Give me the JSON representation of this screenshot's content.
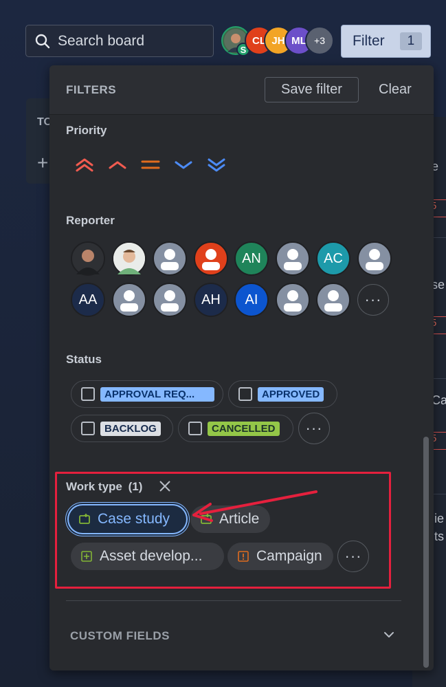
{
  "search": {
    "placeholder": "Search board"
  },
  "header_avatars": [
    {
      "initials": "",
      "color": "#3d6a4a",
      "photo": true
    },
    {
      "initials": "CL",
      "color": "#e0401b"
    },
    {
      "initials": "JH",
      "color": "#f2a425"
    },
    {
      "initials": "ML",
      "color": "#6c4fc9"
    },
    {
      "initials": "+3",
      "color": "#5a6170"
    }
  ],
  "header_badge": "S",
  "filter_button": {
    "label": "Filter",
    "count": "1"
  },
  "board": {
    "column_title": "TO",
    "add_symbol": "+",
    "right_fragments": [
      "e",
      "5",
      "se",
      "5",
      "Ca",
      "5",
      "lie",
      "lts"
    ]
  },
  "panel": {
    "title": "FILTERS",
    "save_label": "Save filter",
    "clear_label": "Clear",
    "priority": {
      "label": "Priority",
      "items": [
        {
          "name": "highest",
          "color": "#f15b50"
        },
        {
          "name": "high",
          "color": "#f15b50"
        },
        {
          "name": "medium",
          "color": "#e06c1f"
        },
        {
          "name": "low",
          "color": "#4c8bf5"
        },
        {
          "name": "lowest",
          "color": "#4c8bf5"
        }
      ]
    },
    "reporter": {
      "label": "Reporter",
      "row1": [
        {
          "initials": "",
          "color": "#3a3c40",
          "kind": "photo-dark"
        },
        {
          "initials": "",
          "color": "#eef1ee",
          "kind": "photo-light"
        },
        {
          "initials": "",
          "color": "#8590a2",
          "kind": "person"
        },
        {
          "initials": "",
          "color": "#e0401b",
          "kind": "person"
        },
        {
          "initials": "AN",
          "color": "#1f845a",
          "kind": "initials"
        },
        {
          "initials": "",
          "color": "#8590a2",
          "kind": "person"
        },
        {
          "initials": "AC",
          "color": "#1d9aaa",
          "kind": "initials"
        },
        {
          "initials": "",
          "color": "#8590a2",
          "kind": "person"
        }
      ],
      "row2": [
        {
          "initials": "AA",
          "color": "#1c2b4a",
          "kind": "initials"
        },
        {
          "initials": "",
          "color": "#8590a2",
          "kind": "person"
        },
        {
          "initials": "",
          "color": "#8590a2",
          "kind": "person"
        },
        {
          "initials": "AH",
          "color": "#1c2b4a",
          "kind": "initials"
        },
        {
          "initials": "AI",
          "color": "#0c55cf",
          "kind": "initials"
        },
        {
          "initials": "",
          "color": "#8590a2",
          "kind": "person"
        },
        {
          "initials": "",
          "color": "#8590a2",
          "kind": "person"
        }
      ],
      "more": "···"
    },
    "status": {
      "label": "Status",
      "items": [
        {
          "label": "APPROVAL REQ...",
          "bg": "#85b8ff",
          "fg": "#09326c"
        },
        {
          "label": "APPROVED",
          "bg": "#85b8ff",
          "fg": "#09326c"
        },
        {
          "label": "BACKLOG",
          "bg": "#dcdfe4",
          "fg": "#172b4d"
        },
        {
          "label": "CANCELLED",
          "bg": "#94c748",
          "fg": "#1c3329"
        }
      ],
      "more": "···"
    },
    "work_type": {
      "label": "Work type",
      "count": "(1)",
      "items": [
        {
          "label": "Case study",
          "icon": "case-study-icon",
          "color": "#82b536",
          "selected": true
        },
        {
          "label": "Article",
          "icon": "article-icon",
          "color": "#82b536",
          "selected": false
        },
        {
          "label": "Asset develop...",
          "icon": "asset-icon",
          "color": "#82b536",
          "selected": false
        },
        {
          "label": "Campaign",
          "icon": "campaign-icon",
          "color": "#e06c1f",
          "selected": false
        }
      ],
      "more": "···"
    },
    "custom_fields": {
      "label": "CUSTOM FIELDS"
    }
  },
  "annotation_color": "#e5203d"
}
